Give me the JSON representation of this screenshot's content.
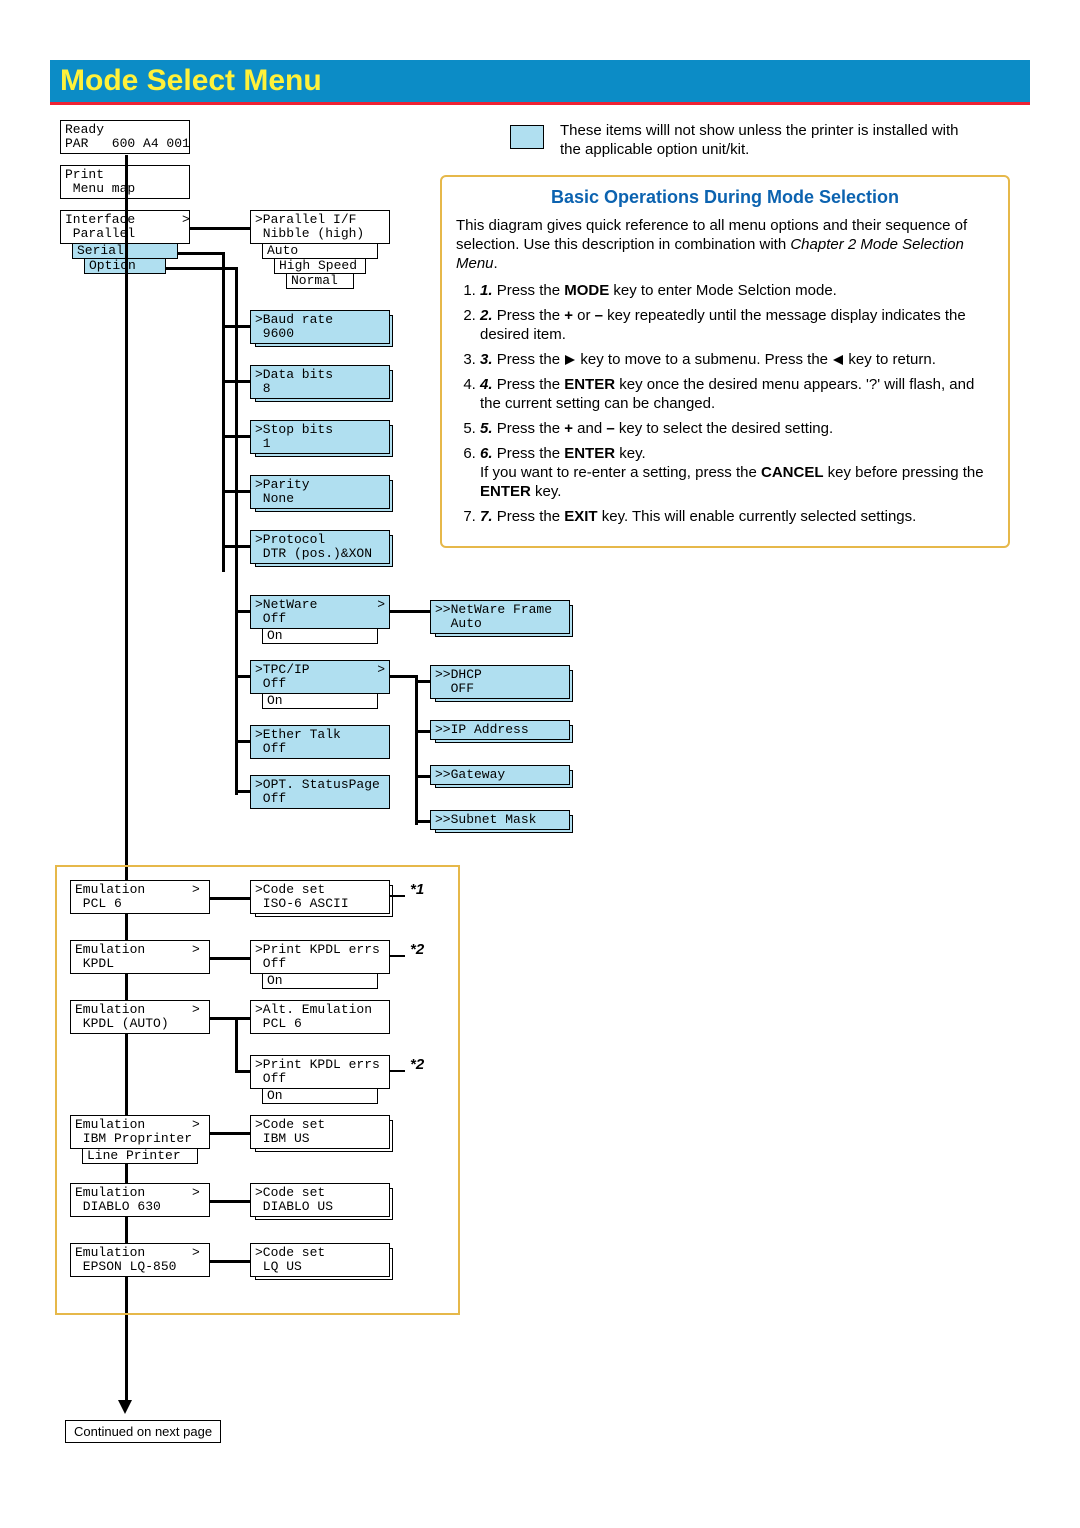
{
  "title": "Mode Select Menu",
  "legend": "These items willl not show unless the printer is installed with the applicable option unit/kit.",
  "ops": {
    "title": "Basic Operations During Mode Selection",
    "intro1": "This diagram gives quick reference to all menu options and their sequence of selection. Use this description in combination with ",
    "intro_ref": "Chapter 2 Mode Selection Menu",
    "steps": {
      "s1a": "Press the ",
      "s1b": "MODE",
      "s1c": " key to enter Mode Selction mode.",
      "s2a": "Press the ",
      "s2b": "+",
      "s2c": " or ",
      "s2d": "–",
      "s2e": " key repeatedly until the message display indicates the desired item.",
      "s3a": "Press the ",
      "s3b": " key to move to a submenu. Press the ",
      "s3c": " key to return.",
      "s4a": "Press the ",
      "s4b": "ENTER",
      "s4c": " key once the desired menu appears.  '?' will flash, and the current setting can be changed.",
      "s5a": "Press the ",
      "s5b": "+",
      "s5c": " and ",
      "s5d": "–",
      "s5e": " key to select the desired setting.",
      "s6a": "Press the ",
      "s6b": "ENTER",
      "s6c": " key.",
      "s6d": "If you want to re-enter a setting, press the ",
      "s6e": "CANCEL",
      "s6f": " key before pressing the ",
      "s6g": "ENTER",
      "s6h": " key.",
      "s7a": "Press the ",
      "s7b": "EXIT",
      "s7c": " key. This will enable currently selected settings."
    }
  },
  "continued": "Continued on next page",
  "m": {
    "ready": "Ready",
    "ready2": "PAR   600 A4 001",
    "print": "Print",
    "print2": " Menu map",
    "interface": "Interface      >",
    "interface2": " Parallel",
    "serial": "  Serial",
    "option": "  Option",
    "parallel": ">Parallel I/F",
    "parallel2": " Nibble (high)",
    "auto": " Auto",
    "highspeed": "   High Speed",
    "normal": "   Normal",
    "baud": ">Baud rate",
    "baud2": " 9600",
    "databits": ">Data bits",
    "databits2": " 8",
    "stopbits": ">Stop bits",
    "stopbits2": " 1",
    "parity": ">Parity",
    "parity2": " None",
    "protocol": ">Protocol",
    "protocol2": " DTR (pos.)&XON",
    "netware": ">NetWare",
    "netware2": " Off",
    "on": "  On",
    "tpcip": ">TPC/IP",
    "tpcip2": " Off",
    "ether": ">Ether Talk",
    "ether2": " Off",
    "optstat": ">OPT. StatusPage",
    "optstat2": " Off",
    "nwframe": ">>NetWare Frame",
    "nwframe2": "  Auto",
    "dhcp": ">>DHCP",
    "dhcp2": "  OFF",
    "ipaddr": ">>IP Address",
    "gateway": ">>Gateway",
    "subnet": ">>Subnet Mask",
    "emu1": "Emulation      >",
    "emu1b": " PCL 6",
    "emu2": "Emulation      >",
    "emu2b": " KPDL",
    "emu3": "Emulation      >",
    "emu3b": " KPDL (AUTO)",
    "emu4": "Emulation      >",
    "emu4b": " IBM Proprinter",
    "lineprinter": "  Line Printer",
    "emu5": "Emulation      >",
    "emu5b": " DIABLO 630",
    "emu6": "Emulation      >",
    "emu6b": " EPSON LQ-850",
    "codeset1": ">Code set",
    "codeset1b": " ISO-6 ASCII",
    "kpdlerr": ">Print KPDL errs",
    "kpdlerr2": " Off",
    "kpdlerr_on": "  On",
    "altemu": ">Alt. Emulation",
    "altemu2": " PCL 6",
    "kpdlerr3": ">Print KPDL errs",
    "kpdlerr3b": " Off",
    "kpdlerr3_on": "  On",
    "codeset4": ">Code set",
    "codeset4b": " IBM US",
    "codeset5": ">Code set",
    "codeset5b": " DIABLO US",
    "codeset6": ">Code set",
    "codeset6b": " LQ US",
    "star1": "*1",
    "star2": "*2"
  }
}
